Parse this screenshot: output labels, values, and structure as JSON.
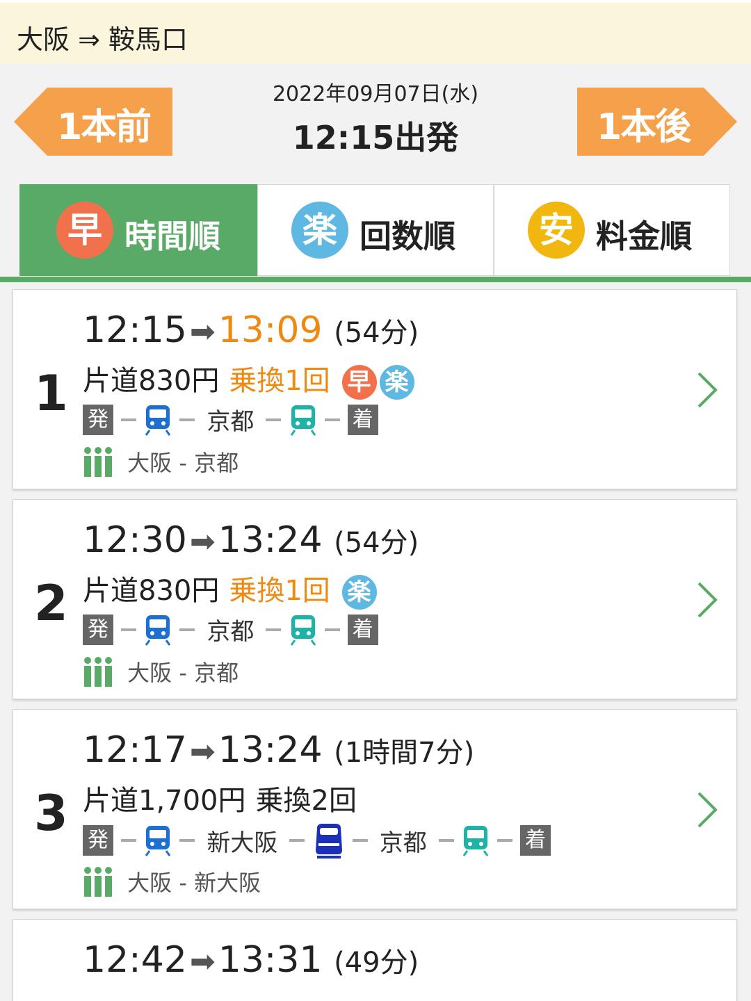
{
  "route": "大阪 ⇒ 鞍馬口",
  "nav": {
    "prev_label": "1本前",
    "next_label": "1本後"
  },
  "search": {
    "date": "2022年09月07日(水)",
    "departure": "12:15出発"
  },
  "tabs": [
    {
      "badge": "早",
      "label": "時間順",
      "active": true
    },
    {
      "badge": "楽",
      "label": "回数順"
    },
    {
      "badge": "安",
      "label": "料金順"
    }
  ],
  "colors": {
    "green": "#5aaa67",
    "orange": "#f5a04a",
    "accent_orange": "#ee8a12",
    "blue_train": "#1d6fd1",
    "teal_train": "#1fb3a8"
  },
  "icons": {
    "prev": "left-arrow-shape",
    "next": "right-arrow-shape",
    "train": "train-icon",
    "shinkansen": "shinkansen-icon",
    "cars": "people-icon",
    "chevron": "chevron-right-icon"
  },
  "results": [
    {
      "num": "1",
      "dep": "12:15",
      "arr": "13:09",
      "dur": "(54分)",
      "fare": "片道830円",
      "transfer": "乗換1回",
      "transfer_highlight": true,
      "badges": [
        "早",
        "楽"
      ],
      "path": {
        "start": "発",
        "stations": [
          "京都"
        ],
        "end": "着"
      },
      "cars": "大阪 - 京都"
    },
    {
      "num": "2",
      "dep": "12:30",
      "arr": "13:24",
      "dur": "(54分)",
      "fare": "片道830円",
      "transfer": "乗換1回",
      "transfer_highlight": true,
      "badges": [
        "楽"
      ],
      "path": {
        "start": "発",
        "stations": [
          "京都"
        ],
        "end": "着"
      },
      "cars": "大阪 - 京都"
    },
    {
      "num": "3",
      "dep": "12:17",
      "arr": "13:24",
      "dur": "(1時間7分)",
      "fare": "片道1,700円",
      "transfer": "乗換2回",
      "transfer_highlight": false,
      "badges": [],
      "path": {
        "start": "発",
        "stations": [
          "新大阪",
          "京都"
        ],
        "end": "着"
      },
      "cars": "大阪 - 新大阪"
    },
    {
      "num": "",
      "dep": "12:42",
      "arr": "13:31",
      "dur": "(49分)"
    }
  ]
}
